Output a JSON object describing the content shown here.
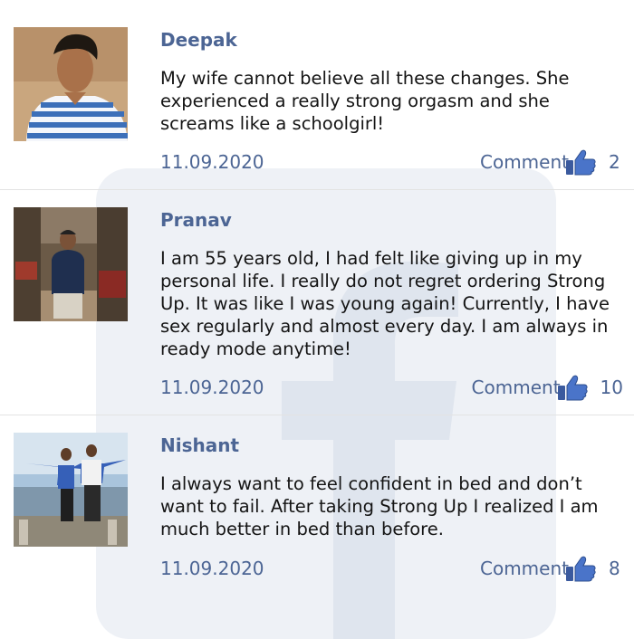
{
  "comments": [
    {
      "name": "Deepak",
      "text": "My wife cannot believe all these changes. She experienced a really strong orgasm and she screams like a schoolgirl!",
      "date": "11.09.2020",
      "comment_label": "Comment",
      "likes": "2"
    },
    {
      "name": "Pranav",
      "text": "I am 55 years old, I had felt like giving up in my personal life. I really do not regret ordering Strong Up. It was like I was young again! Currently, I have sex regularly and almost every day. I am always in ready mode anytime!",
      "date": "11.09.2020",
      "comment_label": "Comment",
      "likes": "10"
    },
    {
      "name": "Nishant",
      "text": "I always want to feel confident in bed and don’t want to fail. After taking Strong Up I realized I am much better in bed than before.",
      "date": "11.09.2020",
      "comment_label": "Comment",
      "likes": "8"
    }
  ],
  "colors": {
    "link": "#4c6594",
    "text": "#141414",
    "watermark": "#eef1f6",
    "like_icon": "#4a74c9"
  },
  "icons": {
    "like": "thumbs-up-icon",
    "watermark": "facebook-f-logo"
  }
}
